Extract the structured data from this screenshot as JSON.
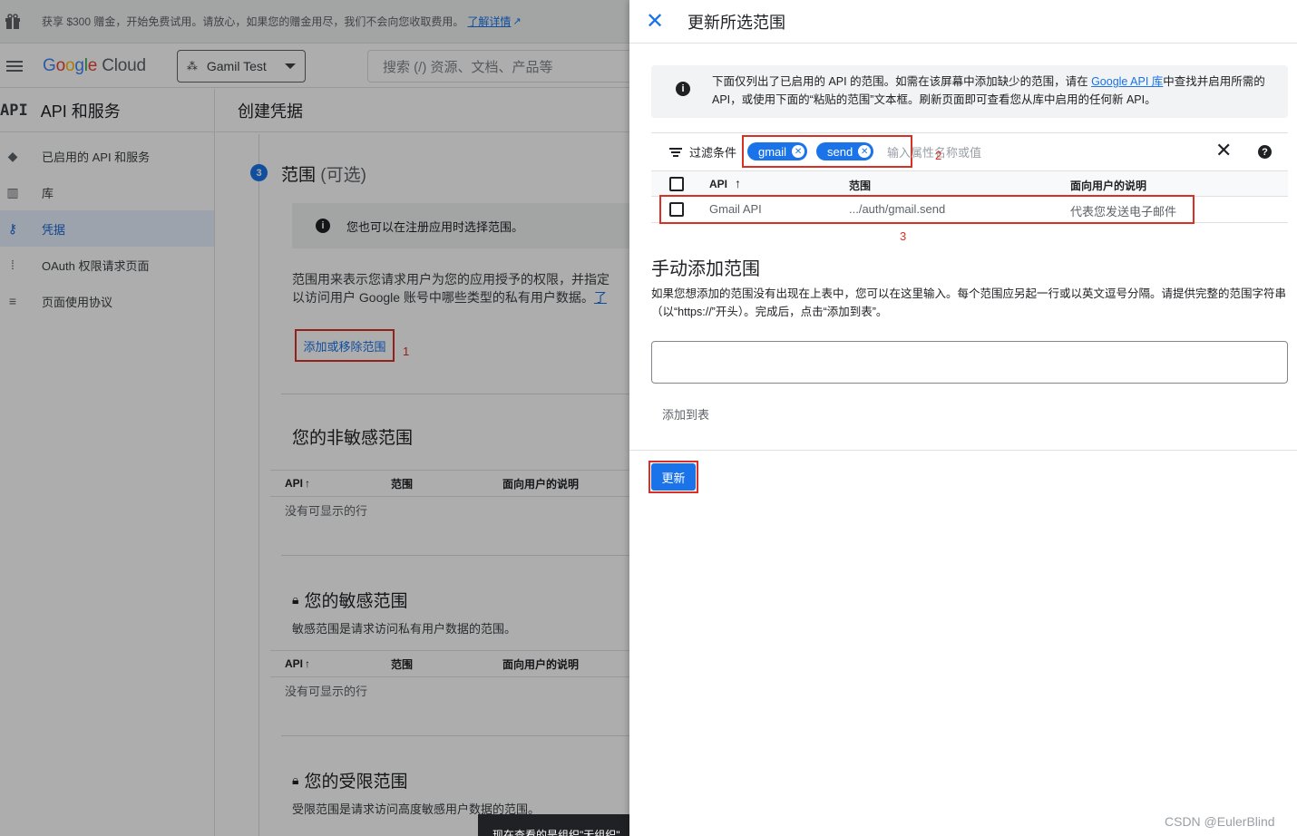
{
  "promo": {
    "text": "获享 $300 赠金，开始免费试用。请放心，如果您的赠金用尽，我们不会向您收取费用。",
    "link": "了解详情"
  },
  "topbar": {
    "logo_cloud": "Cloud",
    "project": "Gamil Test",
    "search_placeholder": "搜索 (/) 资源、文档、产品等"
  },
  "sidebar": {
    "api_mark": "API",
    "title": "API 和服务",
    "items": [
      {
        "label": "已启用的 API 和服务",
        "icon": "◆"
      },
      {
        "label": "库",
        "icon": "▥"
      },
      {
        "label": "凭据",
        "icon": "⚷"
      },
      {
        "label": "OAuth 权限请求页面",
        "icon": "⁞"
      },
      {
        "label": "页面使用协议",
        "icon": "≡"
      }
    ]
  },
  "main": {
    "title": "创建凭据",
    "step_number": "3",
    "step_title": "范围",
    "step_optional": "(可选)",
    "info": "您也可以在注册应用时选择范围。",
    "desc_line1": "范围用来表示您请求用户为您的应用授予的权限，并指定",
    "desc_line2": "以访问用户 Google 账号中哪些类型的私有用户数据。",
    "desc_link": "了",
    "add_remove_button": "添加或移除范围",
    "annotation_1": "1",
    "nonsensitive_title": "您的非敏感范围",
    "sensitive_title": "您的敏感范围",
    "sensitive_desc": "敏感范围是请求访问私有用户数据的范围。",
    "restricted_title": "您的受限范围",
    "restricted_desc": "受限范围是请求访问高度敏感用户数据的范围。",
    "col_api": "API",
    "col_scope": "范围",
    "col_desc": "面向用户的说明",
    "empty": "没有可显示的行",
    "snackbar": "现在查看的是组织\"无组织\""
  },
  "panel": {
    "title": "更新所选范围",
    "info_text_a": "下面仅列出了已启用的 API 的范围。如需在该屏幕中添加缺少的范围，请在 ",
    "info_link": "Google API 库",
    "info_text_b": "中查找并启用所需的 API，或使用下面的“粘贴的范围”文本框。刷新页面即可查看您从库中启用的任何新 API。",
    "filter_label": "过滤条件",
    "chips": [
      "gmail",
      "send"
    ],
    "filter_placeholder": "输入属性名称或值",
    "annotation_2": "2",
    "col_api": "API",
    "col_scope": "范围",
    "col_desc": "面向用户的说明",
    "row": {
      "api": "Gmail API",
      "scope": ".../auth/gmail.send",
      "desc": "代表您发送电子邮件"
    },
    "annotation_3": "3",
    "manual_title": "手动添加范围",
    "manual_desc": "如果您想添加的范围没有出现在上表中，您可以在这里输入。每个范围应另起一行或以英文逗号分隔。请提供完整的范围字符串（以“https://”开头）。完成后，点击“添加到表”。",
    "add_to_table": "添加到表",
    "update_button": "更新"
  },
  "watermark": "CSDN @EulerBlind",
  "colors": {
    "primary": "#1a73e8",
    "annotation": "#d93025"
  }
}
